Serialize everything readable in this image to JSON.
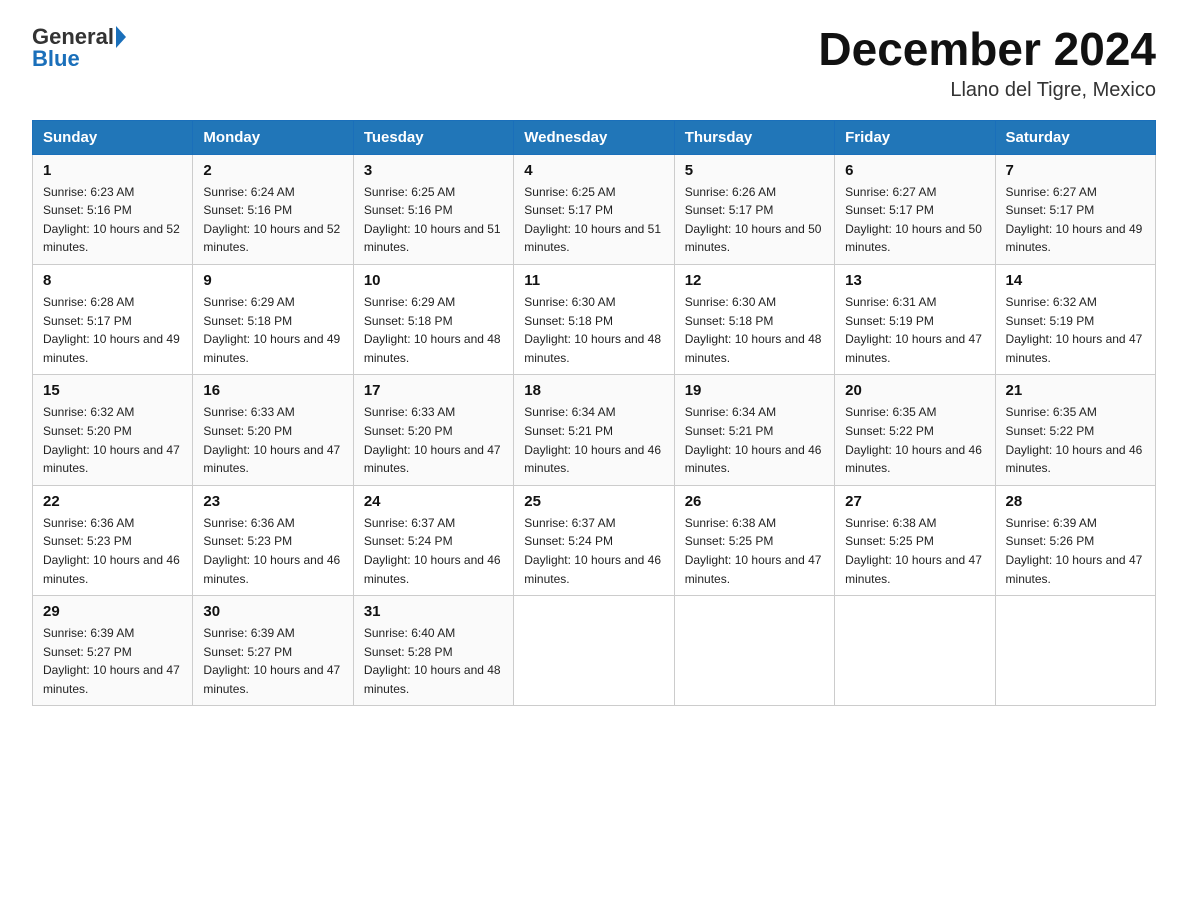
{
  "header": {
    "logo_general": "General",
    "logo_blue": "Blue",
    "title": "December 2024",
    "subtitle": "Llano del Tigre, Mexico"
  },
  "columns": [
    "Sunday",
    "Monday",
    "Tuesday",
    "Wednesday",
    "Thursday",
    "Friday",
    "Saturday"
  ],
  "weeks": [
    [
      {
        "day": 1,
        "sunrise": "6:23 AM",
        "sunset": "5:16 PM",
        "daylight": "10 hours and 52 minutes."
      },
      {
        "day": 2,
        "sunrise": "6:24 AM",
        "sunset": "5:16 PM",
        "daylight": "10 hours and 52 minutes."
      },
      {
        "day": 3,
        "sunrise": "6:25 AM",
        "sunset": "5:16 PM",
        "daylight": "10 hours and 51 minutes."
      },
      {
        "day": 4,
        "sunrise": "6:25 AM",
        "sunset": "5:17 PM",
        "daylight": "10 hours and 51 minutes."
      },
      {
        "day": 5,
        "sunrise": "6:26 AM",
        "sunset": "5:17 PM",
        "daylight": "10 hours and 50 minutes."
      },
      {
        "day": 6,
        "sunrise": "6:27 AM",
        "sunset": "5:17 PM",
        "daylight": "10 hours and 50 minutes."
      },
      {
        "day": 7,
        "sunrise": "6:27 AM",
        "sunset": "5:17 PM",
        "daylight": "10 hours and 49 minutes."
      }
    ],
    [
      {
        "day": 8,
        "sunrise": "6:28 AM",
        "sunset": "5:17 PM",
        "daylight": "10 hours and 49 minutes."
      },
      {
        "day": 9,
        "sunrise": "6:29 AM",
        "sunset": "5:18 PM",
        "daylight": "10 hours and 49 minutes."
      },
      {
        "day": 10,
        "sunrise": "6:29 AM",
        "sunset": "5:18 PM",
        "daylight": "10 hours and 48 minutes."
      },
      {
        "day": 11,
        "sunrise": "6:30 AM",
        "sunset": "5:18 PM",
        "daylight": "10 hours and 48 minutes."
      },
      {
        "day": 12,
        "sunrise": "6:30 AM",
        "sunset": "5:18 PM",
        "daylight": "10 hours and 48 minutes."
      },
      {
        "day": 13,
        "sunrise": "6:31 AM",
        "sunset": "5:19 PM",
        "daylight": "10 hours and 47 minutes."
      },
      {
        "day": 14,
        "sunrise": "6:32 AM",
        "sunset": "5:19 PM",
        "daylight": "10 hours and 47 minutes."
      }
    ],
    [
      {
        "day": 15,
        "sunrise": "6:32 AM",
        "sunset": "5:20 PM",
        "daylight": "10 hours and 47 minutes."
      },
      {
        "day": 16,
        "sunrise": "6:33 AM",
        "sunset": "5:20 PM",
        "daylight": "10 hours and 47 minutes."
      },
      {
        "day": 17,
        "sunrise": "6:33 AM",
        "sunset": "5:20 PM",
        "daylight": "10 hours and 47 minutes."
      },
      {
        "day": 18,
        "sunrise": "6:34 AM",
        "sunset": "5:21 PM",
        "daylight": "10 hours and 46 minutes."
      },
      {
        "day": 19,
        "sunrise": "6:34 AM",
        "sunset": "5:21 PM",
        "daylight": "10 hours and 46 minutes."
      },
      {
        "day": 20,
        "sunrise": "6:35 AM",
        "sunset": "5:22 PM",
        "daylight": "10 hours and 46 minutes."
      },
      {
        "day": 21,
        "sunrise": "6:35 AM",
        "sunset": "5:22 PM",
        "daylight": "10 hours and 46 minutes."
      }
    ],
    [
      {
        "day": 22,
        "sunrise": "6:36 AM",
        "sunset": "5:23 PM",
        "daylight": "10 hours and 46 minutes."
      },
      {
        "day": 23,
        "sunrise": "6:36 AM",
        "sunset": "5:23 PM",
        "daylight": "10 hours and 46 minutes."
      },
      {
        "day": 24,
        "sunrise": "6:37 AM",
        "sunset": "5:24 PM",
        "daylight": "10 hours and 46 minutes."
      },
      {
        "day": 25,
        "sunrise": "6:37 AM",
        "sunset": "5:24 PM",
        "daylight": "10 hours and 46 minutes."
      },
      {
        "day": 26,
        "sunrise": "6:38 AM",
        "sunset": "5:25 PM",
        "daylight": "10 hours and 47 minutes."
      },
      {
        "day": 27,
        "sunrise": "6:38 AM",
        "sunset": "5:25 PM",
        "daylight": "10 hours and 47 minutes."
      },
      {
        "day": 28,
        "sunrise": "6:39 AM",
        "sunset": "5:26 PM",
        "daylight": "10 hours and 47 minutes."
      }
    ],
    [
      {
        "day": 29,
        "sunrise": "6:39 AM",
        "sunset": "5:27 PM",
        "daylight": "10 hours and 47 minutes."
      },
      {
        "day": 30,
        "sunrise": "6:39 AM",
        "sunset": "5:27 PM",
        "daylight": "10 hours and 47 minutes."
      },
      {
        "day": 31,
        "sunrise": "6:40 AM",
        "sunset": "5:28 PM",
        "daylight": "10 hours and 48 minutes."
      },
      null,
      null,
      null,
      null
    ]
  ]
}
